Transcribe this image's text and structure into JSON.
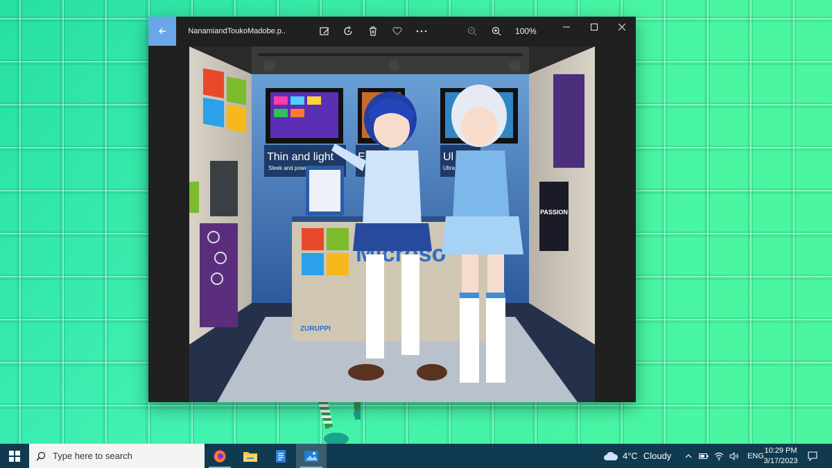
{
  "window": {
    "file_name": "NanamiandToukoMadobe.p...",
    "zoom_level": "100%"
  },
  "image": {
    "banner_1_title": "Thin and light",
    "banner_1_sub": "Sleek and powe",
    "banner_2_title": "E",
    "banner_3_title": "Ul",
    "banner_3_sub": "Ultra n",
    "poster_text": "PASSION",
    "desk_brand": "Microso",
    "signature": "ZURUPPI"
  },
  "taskbar": {
    "search_placeholder": "Type here to search",
    "weather_temp": "4°C",
    "weather_condition": "Cloudy",
    "language": "ENG",
    "time": "10:29 PM",
    "date": "3/17/2023"
  },
  "colors": {
    "accent": "#6aa7e8",
    "taskbar": "#0f3a4f",
    "window_bg": "#202020",
    "wallpaper": "#3ff0b4"
  }
}
